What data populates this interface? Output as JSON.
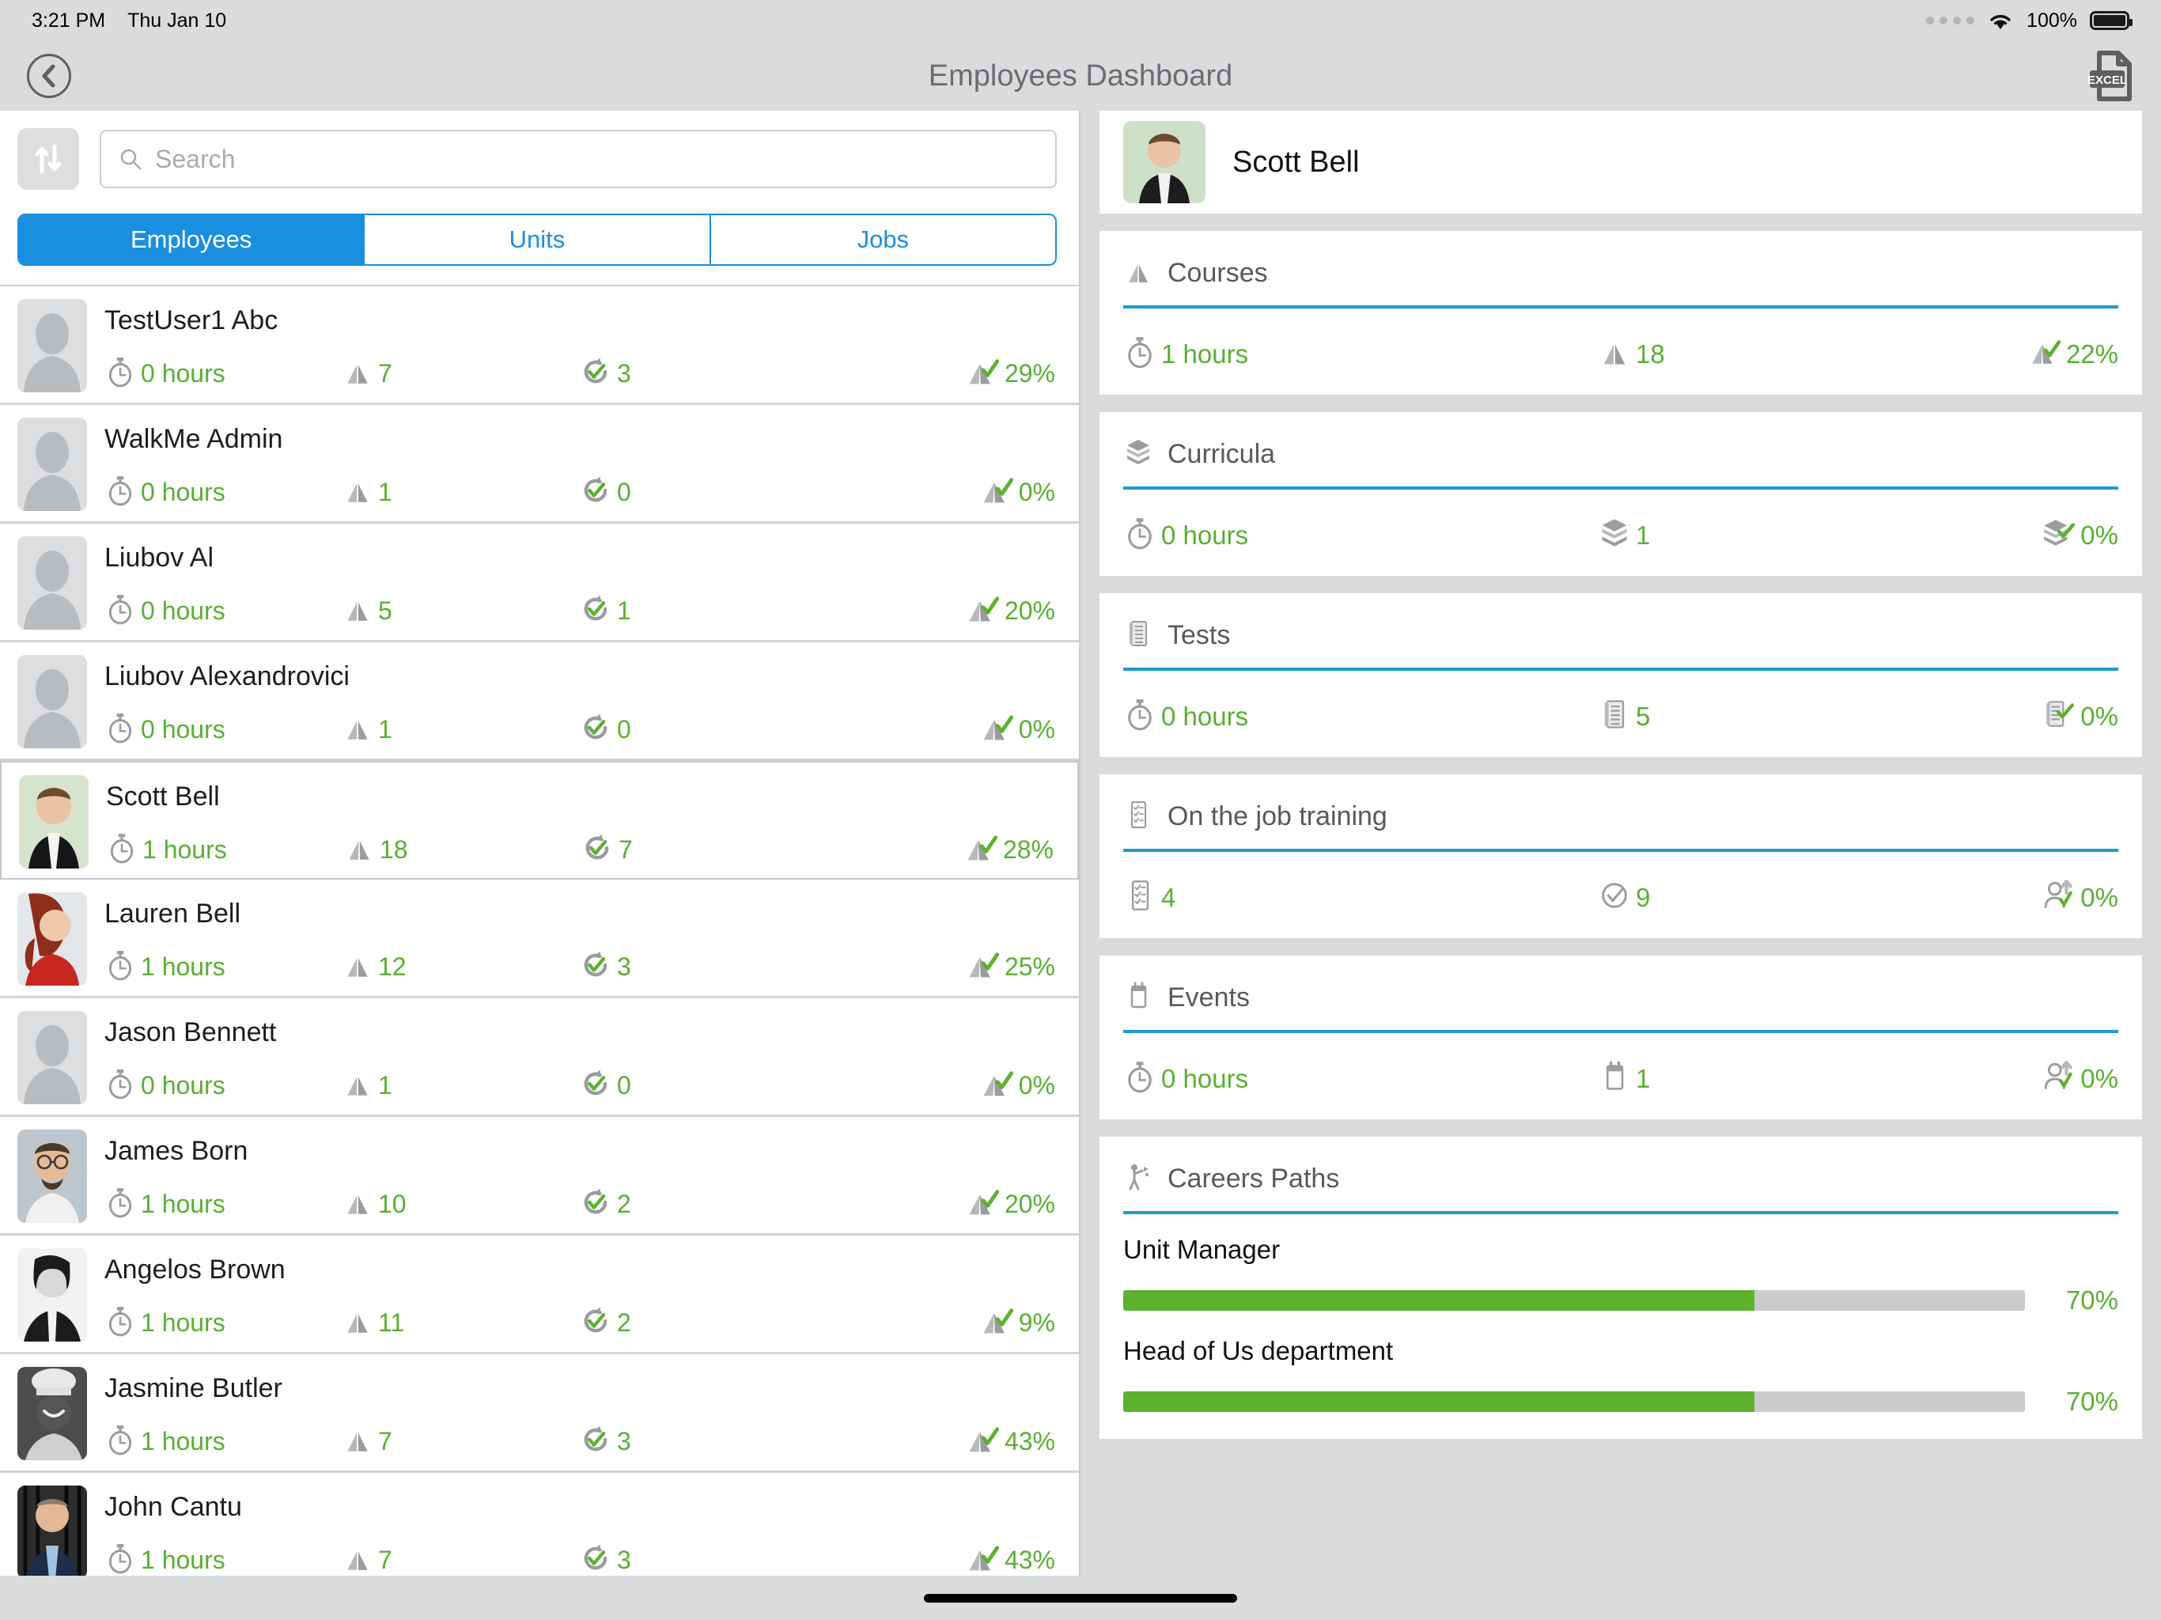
{
  "status_bar": {
    "time": "3:21 PM",
    "date": "Thu Jan 10",
    "battery_percent": "100%",
    "wifi_icon": "wifi-icon",
    "battery_icon": "battery-icon"
  },
  "nav": {
    "back_icon": "chevron-left-circle-icon",
    "title": "Employees Dashboard",
    "export_icon": "excel-file-icon",
    "export_label": "EXCEL"
  },
  "toolbar": {
    "sort_icon": "sort-arrows-icon",
    "search_icon": "search-icon",
    "search_value": "",
    "search_placeholder": "Search"
  },
  "tabs": [
    {
      "label": "Employees",
      "active": true
    },
    {
      "label": "Units",
      "active": false
    },
    {
      "label": "Jobs",
      "active": false
    }
  ],
  "employees": [
    {
      "name": "TestUser1 Abc",
      "hours": "0 hours",
      "courses": "7",
      "completed": "3",
      "progress": "29%",
      "avatar": "placeholder",
      "selected": false
    },
    {
      "name": "WalkMe Admin",
      "hours": "0 hours",
      "courses": "1",
      "completed": "0",
      "progress": "0%",
      "avatar": "placeholder",
      "selected": false
    },
    {
      "name": "Liubov Al",
      "hours": "0 hours",
      "courses": "5",
      "completed": "1",
      "progress": "20%",
      "avatar": "placeholder",
      "selected": false
    },
    {
      "name": "Liubov Alexandrovici",
      "hours": "0 hours",
      "courses": "1",
      "completed": "0",
      "progress": "0%",
      "avatar": "placeholder",
      "selected": false
    },
    {
      "name": "Scott Bell",
      "hours": "1 hours",
      "courses": "18",
      "completed": "7",
      "progress": "28%",
      "avatar": "photo-man-suit",
      "selected": true
    },
    {
      "name": "Lauren Bell",
      "hours": "1 hours",
      "courses": "12",
      "completed": "3",
      "progress": "25%",
      "avatar": "photo-woman-red",
      "selected": false
    },
    {
      "name": "Jason Bennett",
      "hours": "0 hours",
      "courses": "1",
      "completed": "0",
      "progress": "0%",
      "avatar": "placeholder",
      "selected": false
    },
    {
      "name": "James Born",
      "hours": "1 hours",
      "courses": "10",
      "completed": "2",
      "progress": "20%",
      "avatar": "photo-man-glasses",
      "selected": false
    },
    {
      "name": "Angelos Brown",
      "hours": "1 hours",
      "courses": "11",
      "completed": "2",
      "progress": "9%",
      "avatar": "photo-woman-bw",
      "selected": false
    },
    {
      "name": "Jasmine Butler",
      "hours": "1 hours",
      "courses": "7",
      "completed": "3",
      "progress": "43%",
      "avatar": "photo-woman-chef",
      "selected": false
    },
    {
      "name": "John Cantu",
      "hours": "1 hours",
      "courses": "7",
      "completed": "3",
      "progress": "43%",
      "avatar": "photo-man-blue",
      "selected": false
    }
  ],
  "detail": {
    "profile": {
      "name": "Scott Bell",
      "avatar": "photo-man-suit"
    },
    "sections": [
      {
        "title": "Courses",
        "icon": "open-book-icon",
        "stats": [
          {
            "icon": "stopwatch-icon",
            "value": "1 hours"
          },
          {
            "icon": "open-book-icon",
            "value": "18"
          },
          {
            "icon": "book-check-icon",
            "value": "22%"
          }
        ]
      },
      {
        "title": "Curricula",
        "icon": "graduation-stack-icon",
        "stats": [
          {
            "icon": "stopwatch-icon",
            "value": "0 hours"
          },
          {
            "icon": "graduation-stack-icon",
            "value": "1"
          },
          {
            "icon": "curricula-check-icon",
            "value": "0%"
          }
        ]
      },
      {
        "title": "Tests",
        "icon": "test-sheet-icon",
        "stats": [
          {
            "icon": "stopwatch-icon",
            "value": "0 hours"
          },
          {
            "icon": "test-sheet-icon",
            "value": "5"
          },
          {
            "icon": "test-check-icon",
            "value": "0%"
          }
        ]
      },
      {
        "title": "On the job training",
        "icon": "checklist-icon",
        "stats": [
          {
            "icon": "checklist-icon",
            "value": "4"
          },
          {
            "icon": "circle-check-icon",
            "value": "9"
          },
          {
            "icon": "person-check-icon",
            "value": "0%"
          }
        ]
      },
      {
        "title": "Events",
        "icon": "calendar-icon",
        "stats": [
          {
            "icon": "stopwatch-icon",
            "value": "0 hours"
          },
          {
            "icon": "calendar-icon",
            "value": "1"
          },
          {
            "icon": "person-check-icon",
            "value": "0%"
          }
        ]
      }
    ],
    "careers": {
      "title": "Careers Paths",
      "icon": "career-path-icon",
      "paths": [
        {
          "name": "Unit Manager",
          "percent": "70%",
          "value": 70
        },
        {
          "name": "Head of Us department",
          "percent": "70%",
          "value": 70
        }
      ]
    }
  },
  "colors": {
    "accent_blue": "#1a8fe0",
    "rule_blue": "#1d9bd1",
    "value_green": "#58b030",
    "bar_green": "#5cb22c",
    "chrome_gray": "#d9dbdd"
  }
}
